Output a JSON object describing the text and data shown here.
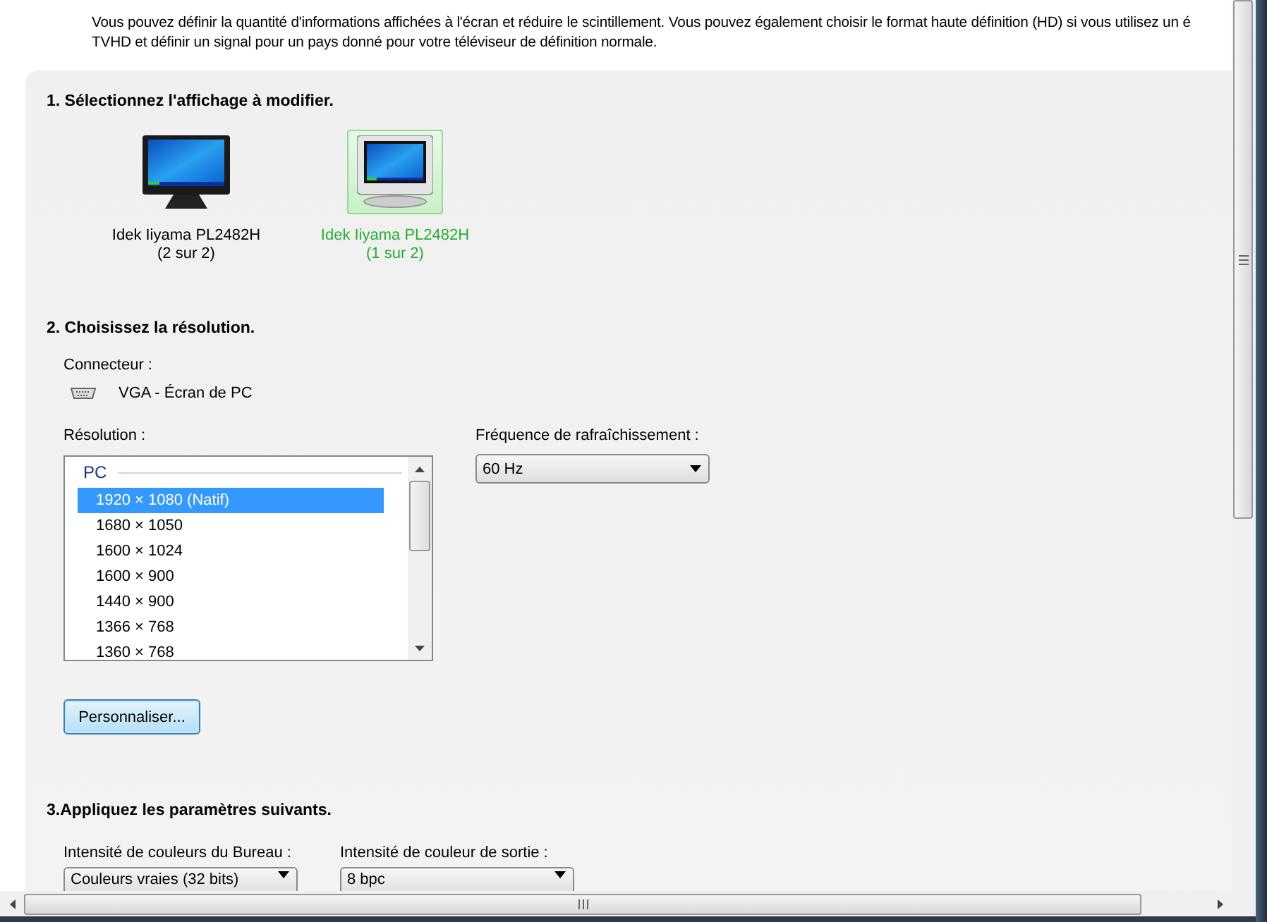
{
  "description_lines": [
    "Vous pouvez définir la quantité d'informations affichées à l'écran et réduire le scintillement. Vous pouvez également choisir le format haute définition (HD) si vous utilisez un é",
    "TVHD et définir un signal pour un pays donné pour votre téléviseur de définition normale."
  ],
  "section_1": {
    "title": "1. Sélectionnez l'affichage à modifier.",
    "displays": [
      {
        "kind": "lcd",
        "name": "Idek Iiyama PL2482H",
        "position": "(2 sur 2)",
        "selected": false
      },
      {
        "kind": "crt",
        "name": "Idek Iiyama PL2482H",
        "position": "(1 sur 2)",
        "selected": true
      }
    ]
  },
  "section_2": {
    "title": "2. Choisissez la résolution.",
    "connector": {
      "label": "Connecteur :",
      "value": "VGA - Écran de PC"
    },
    "resolution": {
      "label": "Résolution :",
      "group": "PC",
      "items": [
        {
          "text": "1920 × 1080 (Natif)",
          "selected": true
        },
        {
          "text": "1680 × 1050",
          "selected": false
        },
        {
          "text": "1600 × 1024",
          "selected": false
        },
        {
          "text": "1600 × 900",
          "selected": false
        },
        {
          "text": "1440 × 900",
          "selected": false
        },
        {
          "text": "1366 × 768",
          "selected": false
        },
        {
          "text": "1360 × 768",
          "selected": false
        }
      ]
    },
    "refresh": {
      "label": "Fréquence de rafraîchissement :",
      "value": "60 Hz"
    },
    "customize_button": "Personnaliser..."
  },
  "section_3": {
    "title": "3.Appliquez les paramètres suivants.",
    "fields": [
      {
        "label": "Intensité de couleurs du Bureau :",
        "value": "Couleurs vraies (32 bits)"
      },
      {
        "label": "Intensité de couleur de sortie :",
        "value": "8 bpc"
      }
    ]
  }
}
